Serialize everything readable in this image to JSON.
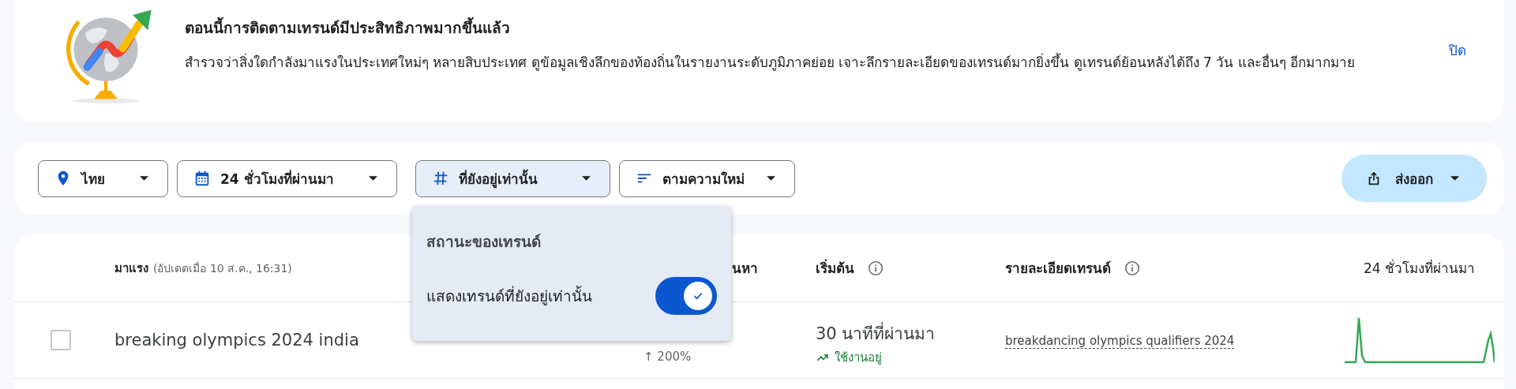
{
  "banner": {
    "title": "ตอนนี้การติดตามเทรนด์มีประสิทธิภาพมากขึ้นแล้ว",
    "description": "สำรวจว่าสิ่งใดกำลังมาแรงในประเทศใหม่ๆ หลายสิบประเทศ ดูข้อมูลเชิงลึกของท้องถิ่นในรายงานระดับภูมิภาคย่อย เจาะลึกรายละเอียดของเทรนด์มากยิ่งขึ้น ดูเทรนด์ย้อนหลังได้ถึง 7 วัน และอื่นๆ อีกมากมาย",
    "close": "ปิด"
  },
  "filters": [
    {
      "kind": "location",
      "label": "ไทย",
      "selected": false
    },
    {
      "kind": "time",
      "label": "24 ชั่วโมงที่ผ่านมา",
      "selected": false
    },
    {
      "kind": "status",
      "label": "ที่ยังอยู่เท่านั้น",
      "selected": true
    },
    {
      "kind": "sort",
      "label": "ตามความใหม่",
      "selected": false
    }
  ],
  "export": {
    "label": "ส่งออก"
  },
  "status_menu": {
    "title": "สถานะของเทรนด์",
    "option": {
      "label": "แสดงเทรนด์ที่ยังอยู่เท่านั้น",
      "on": true
    }
  },
  "table": {
    "header": {
      "trending": "มาแรง",
      "updated": "(อัปเดตเมื่อ 10 ส.ค., 16:31)",
      "column_2": "นหา",
      "started": "เริ่มต้น",
      "details": "รายละเอียดเทรนด์",
      "chart": "24 ชั่วโมงที่ผ่านมา"
    },
    "rows": [
      {
        "checked": false,
        "name": "breaking olympics 2024 india",
        "change": "↑ 200%",
        "started": "30 นาทีที่ผ่านมา",
        "status": "ใช้งานอยู่",
        "active": true,
        "detail": "breakdancing olympics qualifiers 2024"
      }
    ]
  }
}
